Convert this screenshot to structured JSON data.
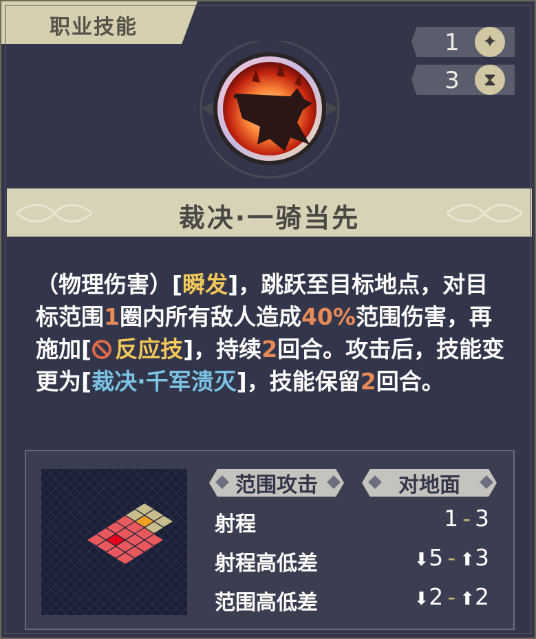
{
  "header": {
    "tab_label": "职业技能"
  },
  "resources": [
    {
      "value": "1",
      "icon": "spark-icon"
    },
    {
      "value": "3",
      "icon": "hourglass-icon"
    }
  ],
  "skill": {
    "icon": "charging-knight-icon",
    "name": "裁决·一骑当先"
  },
  "description": {
    "p1": "（物理伤害）[",
    "instant": "瞬发",
    "p2": "]，跳跃至目标地点，对目标范围",
    "range": "1",
    "p3": "圈内所有敌人造成",
    "damage": "40%",
    "p4": "范围伤害，再施加[",
    "status_icon": "prohibited-icon",
    "status": "反应技",
    "p5": "]，持续",
    "duration": "2",
    "p6": "回合。攻击后，技能变更为[",
    "transform": "裁决·千军溃灭",
    "p7": "]，技能保留",
    "keep": "2",
    "p8": "回合。"
  },
  "info": {
    "tags": [
      "范围攻击",
      "对地面"
    ],
    "stats": [
      {
        "label": "射程",
        "low": "1",
        "high": "3"
      },
      {
        "label": "射程高低差",
        "low": "5",
        "high": "3"
      },
      {
        "label": "范围高低差",
        "low": "2",
        "high": "2"
      }
    ],
    "colors": {
      "range_area": "#e8585c",
      "target_center": "#e8001a",
      "move_area": "#c9bd8c",
      "origin": "#f0a020"
    }
  }
}
